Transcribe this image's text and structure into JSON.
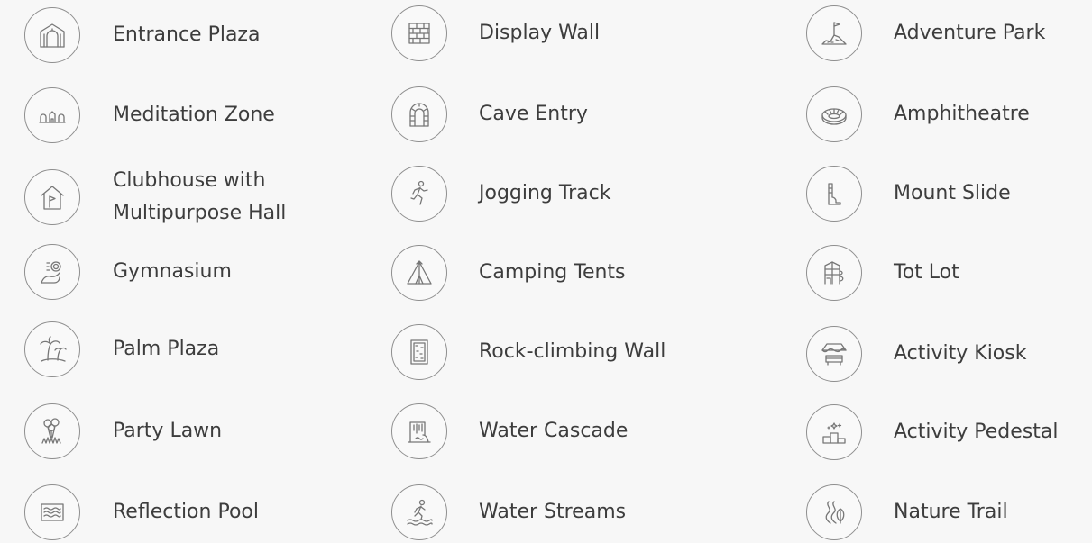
{
  "amenities": [
    {
      "label": "Entrance Plaza",
      "icon": "arch-gate-icon"
    },
    {
      "label": "Meditation Zone",
      "icon": "meditation-huts-icon"
    },
    {
      "label": "Clubhouse with",
      "label2": "Multipurpose Hall",
      "icon": "house-flag-icon"
    },
    {
      "label": "Gymnasium",
      "icon": "flexed-arm-icon"
    },
    {
      "label": "Palm Plaza",
      "icon": "palm-trees-icon"
    },
    {
      "label": "Party Lawn",
      "icon": "balloons-icon"
    },
    {
      "label": "Reflection Pool",
      "icon": "water-pool-icon"
    },
    {
      "label": "Display Wall",
      "icon": "brick-wall-icon"
    },
    {
      "label": "Cave Entry",
      "icon": "cave-arch-icon"
    },
    {
      "label": "Jogging Track",
      "icon": "runner-icon"
    },
    {
      "label": "Camping Tents",
      "icon": "tent-icon"
    },
    {
      "label": "Rock-climbing Wall",
      "icon": "climbing-wall-icon"
    },
    {
      "label": "Water Cascade",
      "icon": "waterfall-icon"
    },
    {
      "label": "Water Streams",
      "icon": "wading-person-icon"
    },
    {
      "label": "Adventure Park",
      "icon": "flag-mound-icon"
    },
    {
      "label": "Amphitheatre",
      "icon": "amphitheatre-icon"
    },
    {
      "label": "Mount Slide",
      "icon": "slide-icon"
    },
    {
      "label": "Tot Lot",
      "icon": "play-structure-icon"
    },
    {
      "label": "Activity Kiosk",
      "icon": "kiosk-icon"
    },
    {
      "label": "Activity Pedestal",
      "icon": "podium-icon"
    },
    {
      "label": "Nature Trail",
      "icon": "trail-leaf-icon"
    }
  ]
}
